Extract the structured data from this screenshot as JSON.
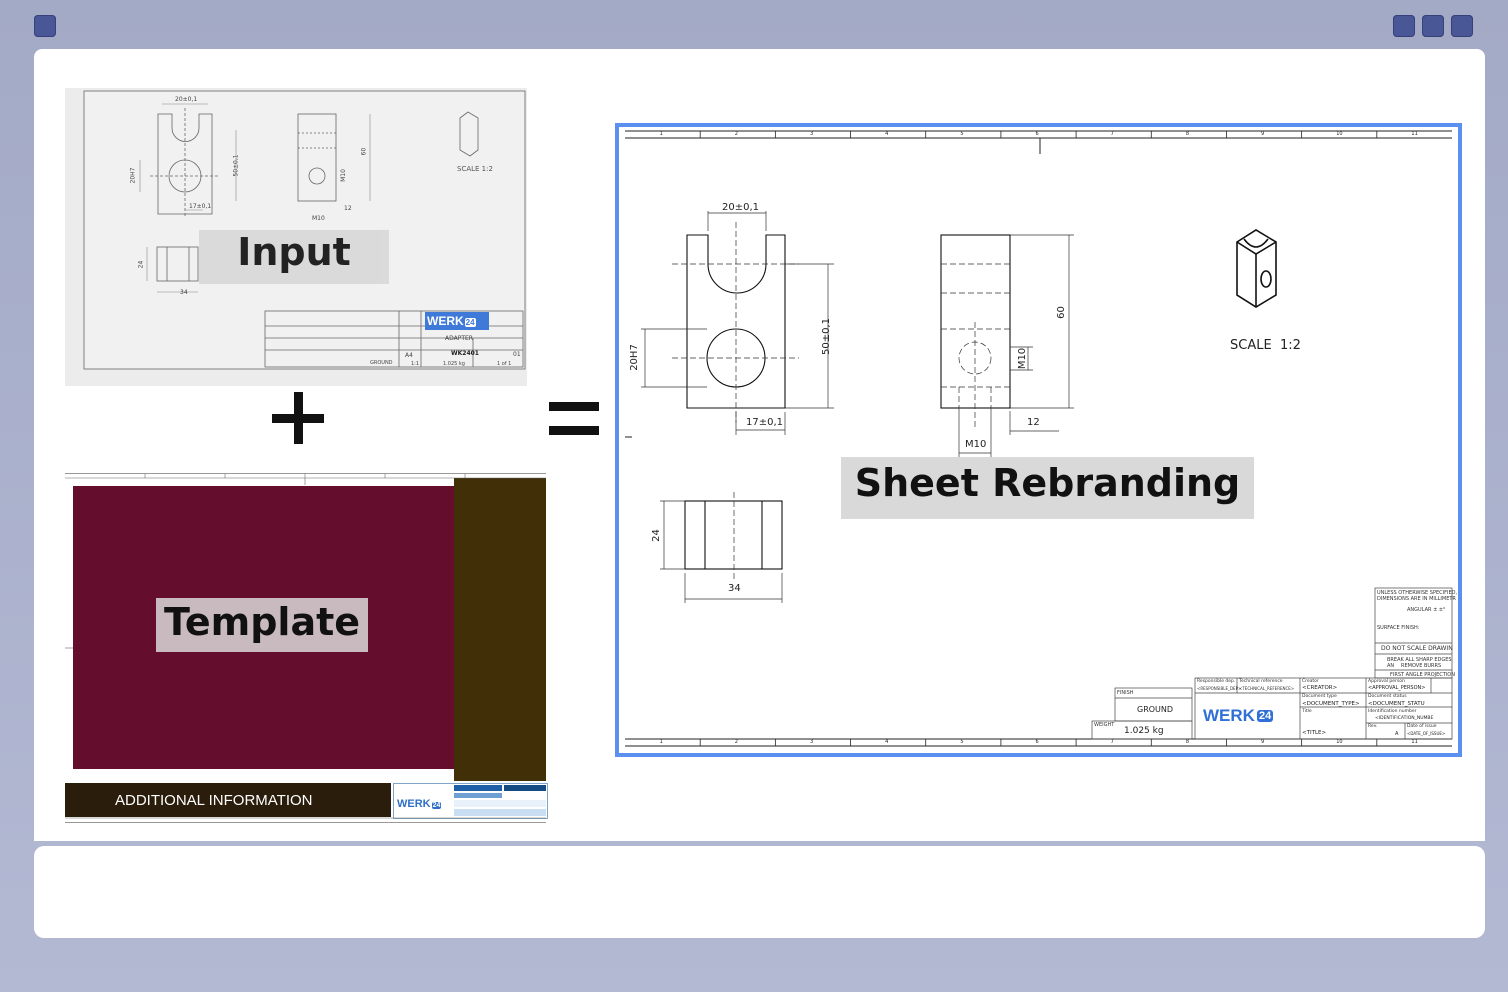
{
  "labels": {
    "input": "Input",
    "template": "Template",
    "sheet_rebranding": "Sheet Rebranding",
    "plus": "+",
    "equals": "="
  },
  "input_drawing": {
    "dim_width": "20±0,1",
    "dim_hole": "20H7",
    "dim_offset": "17±0,1",
    "dim_height": "50±0,1",
    "dim_total": "60",
    "dim_thread": "M10",
    "dim_side": "12",
    "dim_bottom_w": "34",
    "dim_bottom_h": "24",
    "scale": "SCALE  1:2",
    "brand": "WERK",
    "brand_num": "24",
    "title": "ADAPTER",
    "part_no": "WK2401",
    "size": "A4",
    "rev": "01",
    "finish": "GROUND",
    "weight": "1.025 kg",
    "scale_cell": "1:1",
    "sheet": "1 of 1"
  },
  "template": {
    "additional_info": "ADDITIONAL INFORMATION",
    "brand": "WERK",
    "brand_num": "24",
    "colors": {
      "main": "#650d2c",
      "side": "#412f08",
      "bar": "#2b1d0b"
    }
  },
  "output_drawing": {
    "dim_width": "20±0,1",
    "dim_hole": "20H7",
    "dim_offset": "17±0,1",
    "dim_height": "50±0,1",
    "dim_total": "60",
    "dim_thread_v": "M10",
    "dim_thread_h": "M10",
    "dim_side": "12",
    "dim_bottom_w": "34",
    "dim_bottom_h": "24",
    "scale": "SCALE  1:2",
    "ruler": [
      "1",
      "2",
      "3",
      "4",
      "5",
      "6",
      "7",
      "8",
      "9",
      "10",
      "11"
    ],
    "notes": {
      "unless": "UNLESS OTHERWISE SPECIFIED,",
      "dims": "DIMENSIONS ARE IN MILLIMETR",
      "angular": "ANGULAR ± ±°",
      "surface": "SURFACE FINISH:",
      "no_scale": "DO NOT SCALE DRAWIN",
      "break1": "BREAK ALL SHARP EDGES AN",
      "break2": "REMOVE BURRS",
      "projection": "FIRST ANGLE PROJECTION"
    },
    "finish_label": "FINISH",
    "finish": "GROUND",
    "weight_label": "WEIGHT",
    "weight": "1.025 kg",
    "title_block": {
      "resp_label": "Responsible dep.",
      "resp_value": "<RESPONSIBLE_DEP>",
      "tech_label": "Technical reference",
      "tech_value": "<TECHNICAL_REFERENCE>",
      "creator_label": "Creator",
      "creator_value": "<CREATOR>",
      "approval_label": "Approval person",
      "approval_value": "<APPROVAL_PERSON>",
      "doctype_label": "Document type",
      "doctype_value": "<DOCUMENT_TYPE>",
      "docstatus_label": "Document status",
      "docstatus_value": "<DOCUMENT_STATU",
      "title_label": "Title",
      "title_value": "<TITLE>",
      "ident_label": "Identification number",
      "ident_value": "<IDENTIFICATION_NUMBE",
      "rev_label": "Rev.",
      "rev_value": "A",
      "date_label": "Date of issue",
      "date_value": "<DATE_OF_ISSUE>",
      "brand": "WERK",
      "brand_num": "24"
    }
  }
}
